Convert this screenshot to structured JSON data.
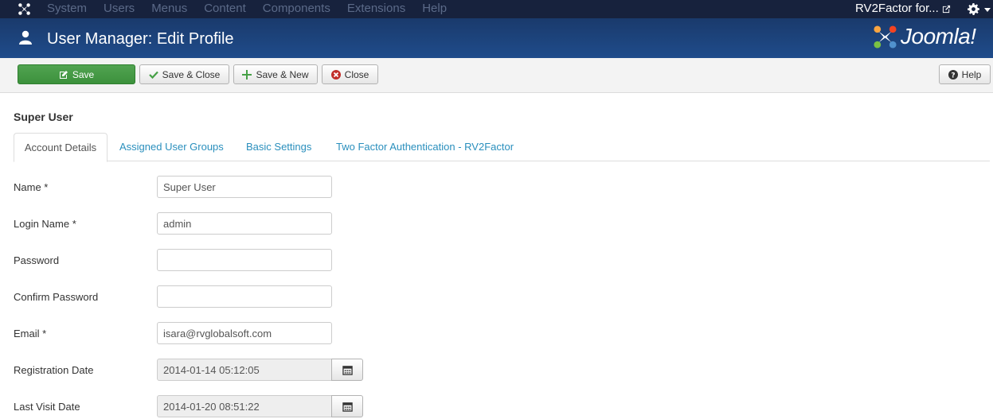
{
  "navbar": {
    "menu": [
      "System",
      "Users",
      "Menus",
      "Content",
      "Components",
      "Extensions",
      "Help"
    ],
    "site_name": "RV2Factor for..."
  },
  "header": {
    "title": "User Manager: Edit Profile",
    "brand": "Joomla!"
  },
  "toolbar": {
    "save_label": "Save",
    "save_close_label": "Save & Close",
    "save_new_label": "Save & New",
    "close_label": "Close",
    "help_label": "Help"
  },
  "content": {
    "heading": "Super User",
    "tabs": [
      "Account Details",
      "Assigned User Groups",
      "Basic Settings",
      "Two Factor Authentication - RV2Factor"
    ],
    "fields": [
      {
        "label": "Name *",
        "value": ""
      },
      {
        "label": "Login Name *",
        "value": "admin"
      },
      {
        "label": "Password",
        "value": ""
      },
      {
        "label": "Confirm Password",
        "value": ""
      },
      {
        "label": "Email *",
        "value": "isara@rvglobalsoft.com"
      },
      {
        "label": "Registration Date",
        "value": "2014-01-14 05:12:05"
      },
      {
        "label": "Last Visit Date",
        "value": "2014-01-20 08:51:22"
      }
    ],
    "name_value": "Super User"
  },
  "colors": {
    "navbar_bg": "#17223d",
    "header_bg": "#1f4c8b",
    "save_green": "#46a046",
    "link_blue": "#2a8fbd"
  }
}
